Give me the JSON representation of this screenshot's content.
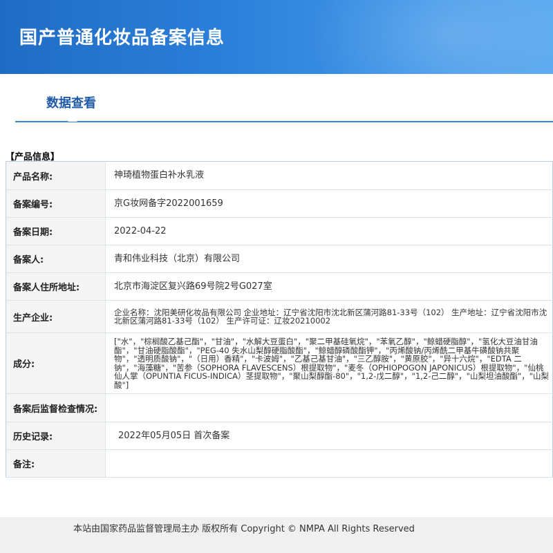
{
  "header": {
    "title": "国产普通化妆品备案信息"
  },
  "tab": {
    "label": "数据查看"
  },
  "section": {
    "label": "【产品信息】"
  },
  "rows": [
    {
      "label": "产品名称:",
      "value": "神琦植物蛋白补水乳液"
    },
    {
      "label": "备案编号:",
      "value": "京G妆网备字2022001659"
    },
    {
      "label": "备案日期:",
      "value": "2022-04-22"
    },
    {
      "label": "备案人:",
      "value": "青和伟业科技（北京）有限公司"
    },
    {
      "label": "备案人住所地址:",
      "value": "北京市海淀区复兴路69号院2号G027室"
    },
    {
      "label": "生产企业:",
      "value": "企业名称：沈阳美研化妆品有限公司 企业地址：辽宁省沈阳市沈北新区蒲河路81-33号（102） 生产地址：辽宁省沈阳市沈北新区蒲河路81-33号（102） 生产许可证：辽妆20210002"
    },
    {
      "label": "成分:",
      "value": "[\"水\"，\"棕榈酸乙基己酯\"，\"甘油\"，\"水解大豆蛋白\"，\"聚二甲基硅氧烷\"，\"苯氧乙醇\"，\"鲸蜡硬脂醇\"，\"氢化大豆油甘油酯\"，\"甘油硬脂酸酯\"，\"PEG-40 失水山梨醇硬脂酸酯\"，\"鲸蜡醇磷酸酯钾\"，\"丙烯酸钠/丙烯酰二甲基牛磺酸钠共聚物\"，\"透明质酸钠\"，\"（日用）香精\"，\"卡波姆\"，\"乙基己基甘油\"，\"三乙醇胺\"，\"黄原胶\"，\"异十六烷\"，\"EDTA 二钠\"，\"海藻糖\"，\"苦参（SOPHORA FLAVESCENS）根提取物\"，\"麦冬（OPHIOPOGON JAPONICUS）根提取物\"，\"仙桃仙人掌（OPUNTIA FICUS-INDICA）茎提取物\"，\"聚山梨醇酯-80\"，\"1,2-戊二醇\"，\"1,2-己二醇\"，\"山梨坦油酸酯\"，\"山梨酸\"]"
    },
    {
      "label": "备案后监督检查情况:",
      "value": ""
    },
    {
      "label": "历史记录:",
      "value": "2022年05月05日 首次备案"
    },
    {
      "label": "备注:",
      "value": ""
    }
  ],
  "footer": {
    "text": "本站由国家药品监督管理局主办 版权所有 Copyright © NMPA All Rights Reserved"
  }
}
